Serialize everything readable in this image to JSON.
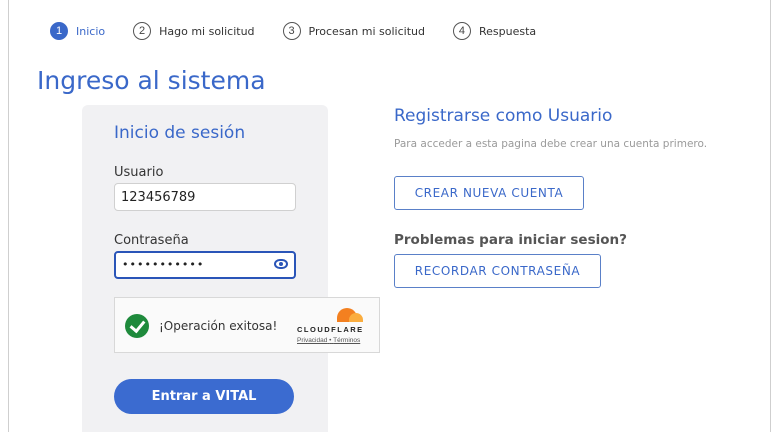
{
  "steps": [
    {
      "num": "1",
      "label": "Inicio"
    },
    {
      "num": "2",
      "label": "Hago mi solicitud"
    },
    {
      "num": "3",
      "label": "Procesan mi solicitud"
    },
    {
      "num": "4",
      "label": "Respuesta"
    }
  ],
  "page_title": "Ingreso al sistema",
  "login": {
    "title": "Inicio de sesión",
    "user_label": "Usuario",
    "user_value": "123456789",
    "password_label": "Contraseña",
    "password_value": "•••••••••••",
    "submit_label": "Entrar a VITAL"
  },
  "captcha": {
    "status": "¡Operación exitosa!",
    "brand": "CLOUDFLARE",
    "privacy": "Privacidad",
    "separator": "•",
    "terms": "Términos"
  },
  "register": {
    "title": "Registrarse como Usuario",
    "description": "Para acceder a esta pagina debe crear una cuenta primero.",
    "create_button": "CREAR NUEVA CUENTA",
    "problems_heading": "Problemas para iniciar sesion?",
    "remember_button": "RECORDAR CONTRASEÑA"
  },
  "colors": {
    "accent": "#3a68c9",
    "success": "#1e8a3c",
    "cloudflare": "#f38020"
  },
  "icons": {
    "password_toggle": "eye-icon",
    "captcha_status": "check-circle-icon"
  }
}
